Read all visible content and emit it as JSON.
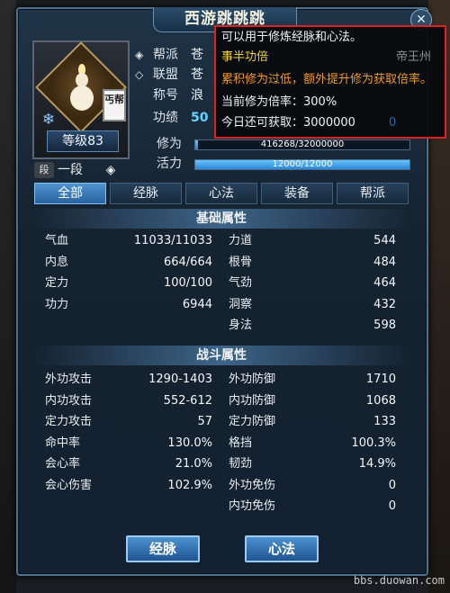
{
  "window": {
    "title": "西游跳跳跳",
    "close_label": "✕"
  },
  "profile": {
    "sect_badge": "丐帮",
    "level": "等级83",
    "rank_icon_label": "段",
    "rank": "一段",
    "sect_label": "帮派",
    "sect_value": "苍",
    "alliance_label": "联盟",
    "alliance_value": "苍",
    "title_label": "称号",
    "title_value": "浪",
    "merit_label": "功绩",
    "merit_value": "50"
  },
  "bars": {
    "cultivation_label": "修为",
    "cultivation_text": "416268/32000000",
    "cultivation_fraction": 0.013,
    "vitality_label": "活力",
    "vitality_text": "12000/12000",
    "vitality_fraction": 1.0
  },
  "tabs": [
    "全部",
    "经脉",
    "心法",
    "装备",
    "帮派"
  ],
  "basic": {
    "heading": "基础属性",
    "rows": [
      {
        "l_name": "气血",
        "l_val": "11033/11033",
        "r_name": "力道",
        "r_val": "544"
      },
      {
        "l_name": "内息",
        "l_val": "664/664",
        "r_name": "根骨",
        "r_val": "484"
      },
      {
        "l_name": "定力",
        "l_val": "100/100",
        "r_name": "气劲",
        "r_val": "464"
      },
      {
        "l_name": "功力",
        "l_val": "6944",
        "r_name": "洞察",
        "r_val": "432"
      },
      {
        "l_name": "",
        "l_val": "",
        "r_name": "身法",
        "r_val": "598"
      }
    ]
  },
  "combat": {
    "heading": "战斗属性",
    "rows": [
      {
        "l_name": "外功攻击",
        "l_val": "1290-1403",
        "r_name": "外功防御",
        "r_val": "1710"
      },
      {
        "l_name": "内功攻击",
        "l_val": "552-612",
        "r_name": "内功防御",
        "r_val": "1068"
      },
      {
        "l_name": "定力攻击",
        "l_val": "57",
        "r_name": "定力防御",
        "r_val": "133"
      },
      {
        "l_name": "命中率",
        "l_val": "130.0%",
        "r_name": "格挡",
        "r_val": "100.3%"
      },
      {
        "l_name": "会心率",
        "l_val": "21.0%",
        "r_name": "韧劲",
        "r_val": "14.9%"
      },
      {
        "l_name": "会心伤害",
        "l_val": "102.9%",
        "r_name": "外功免伤",
        "r_val": "0"
      },
      {
        "l_name": "",
        "l_val": "",
        "r_name": "内功免伤",
        "r_val": "0"
      }
    ]
  },
  "buttons": {
    "meridian": "经脉",
    "mind": "心法"
  },
  "tooltip": {
    "line1": "可以用于修炼经脉和心法。",
    "line2": "事半功倍",
    "line3": "累积修为过低，额外提升修为获取倍率。",
    "line4": "当前修为倍率：300%",
    "line5": "今日还可获取：3000000",
    "behind_text": "帝王州",
    "behind_zero": "0"
  },
  "watermark": "bbs.duowan.com"
}
